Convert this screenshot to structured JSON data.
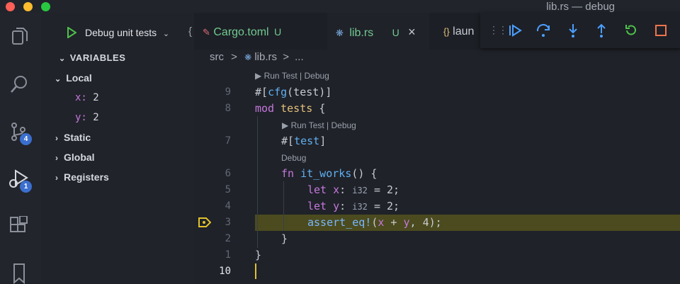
{
  "window": {
    "title": "lib.rs — debug"
  },
  "activity": {
    "items": [
      {
        "name": "explorer"
      },
      {
        "name": "search"
      },
      {
        "name": "source-control",
        "badge": "4"
      },
      {
        "name": "run-debug",
        "badge": "1"
      },
      {
        "name": "extensions"
      },
      {
        "name": "bookmarks"
      }
    ]
  },
  "run": {
    "config": "Debug unit tests"
  },
  "variables": {
    "header": "VARIABLES",
    "local": "Local",
    "vars": [
      {
        "name": "x:",
        "value": "2"
      },
      {
        "name": "y:",
        "value": "2"
      }
    ],
    "groups": [
      "Static",
      "Global",
      "Registers"
    ]
  },
  "tabs": [
    {
      "label": "Cargo.toml",
      "status": "U"
    },
    {
      "label": "lib.rs",
      "status": "U",
      "close": "×"
    },
    {
      "label": "laun"
    }
  ],
  "breadcrumb": {
    "folder": "src",
    "sep": ">",
    "file": "lib.rs",
    "rest": "..."
  },
  "codelens": {
    "run_debug": "▶ Run Test | Debug",
    "debug": "Debug"
  },
  "lines": [
    {
      "num": "9"
    },
    {
      "num": "8"
    },
    {
      "num": "7"
    },
    {
      "num": "6"
    },
    {
      "num": "5"
    },
    {
      "num": "4"
    },
    {
      "num": "3"
    },
    {
      "num": "2"
    },
    {
      "num": "1"
    },
    {
      "num": "10"
    }
  ],
  "code": {
    "cfg_hash": "#[",
    "cfg": "cfg",
    "cfg_arg": "(test)]",
    "mod": "mod",
    "tests": "tests",
    "ob": "{",
    "test_attr_hash": "#[",
    "test_attr": "test",
    "cb": "]",
    "fn": "fn",
    "fn_name": "it_works",
    "fn_rest": "() {",
    "let": "let",
    "x": "x",
    "y": "y",
    "colon": ":",
    "i32": "i32",
    "eq2": "= 2;",
    "assert": "assert_eq!",
    "paren_open": "(",
    "plus": " + ",
    "comma": ", ",
    "four": "4",
    "close": ");",
    "cb_inner": "}",
    "cb_outer": "}"
  },
  "colors": {
    "accent": "#3b6fcf",
    "highlight": "#4b4b1f",
    "breakpoint": "#e2c22d",
    "untracked": "#73c991"
  }
}
